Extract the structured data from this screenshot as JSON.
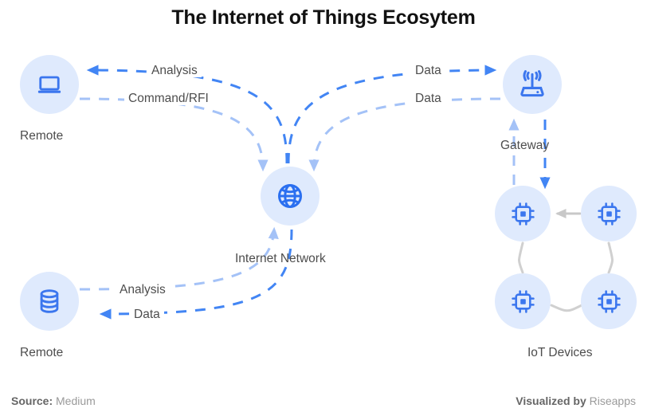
{
  "title": "The Internet of Things Ecosytem",
  "colors": {
    "accent_dark": "#4285f4",
    "accent_light": "#a4c2f7",
    "node_bg": "#dfeafd",
    "icon": "#3b76ee",
    "device_link": "#d0d0d0",
    "text": "#4d4d4d",
    "title": "#111111",
    "footer": "#9a9a9a"
  },
  "nodes": [
    {
      "id": "remote_laptop",
      "label": "Remote",
      "icon": "laptop-icon"
    },
    {
      "id": "remote_database",
      "label": "Remote",
      "icon": "database-icon"
    },
    {
      "id": "internet_network",
      "label": "Internet Network",
      "icon": "globe-icon"
    },
    {
      "id": "gateway",
      "label": "Gateway",
      "icon": "router-icon"
    },
    {
      "id": "iot_devices",
      "label": "IoT Devices",
      "icon": "chip-icon"
    }
  ],
  "edges": [
    {
      "id": "e1",
      "label": "Analysis",
      "tone": "dark",
      "from": "internet_network",
      "to": "remote_laptop"
    },
    {
      "id": "e2",
      "label": "Command/RFI",
      "tone": "light",
      "from": "remote_laptop",
      "to": "internet_network"
    },
    {
      "id": "e3",
      "label": "Data",
      "tone": "dark",
      "from": "internet_network",
      "to": "gateway"
    },
    {
      "id": "e4",
      "label": "Data",
      "tone": "light",
      "from": "gateway",
      "to": "internet_network"
    },
    {
      "id": "e5",
      "label": "Analysis",
      "tone": "light",
      "from": "remote_database",
      "to": "internet_network"
    },
    {
      "id": "e6",
      "label": "Data",
      "tone": "dark",
      "from": "internet_network",
      "to": "remote_database"
    }
  ],
  "device_count": 4,
  "footer": {
    "source_label": "Source:",
    "source_value": "Medium",
    "credit_label": "Visualized by",
    "credit_value": "Riseapps"
  }
}
